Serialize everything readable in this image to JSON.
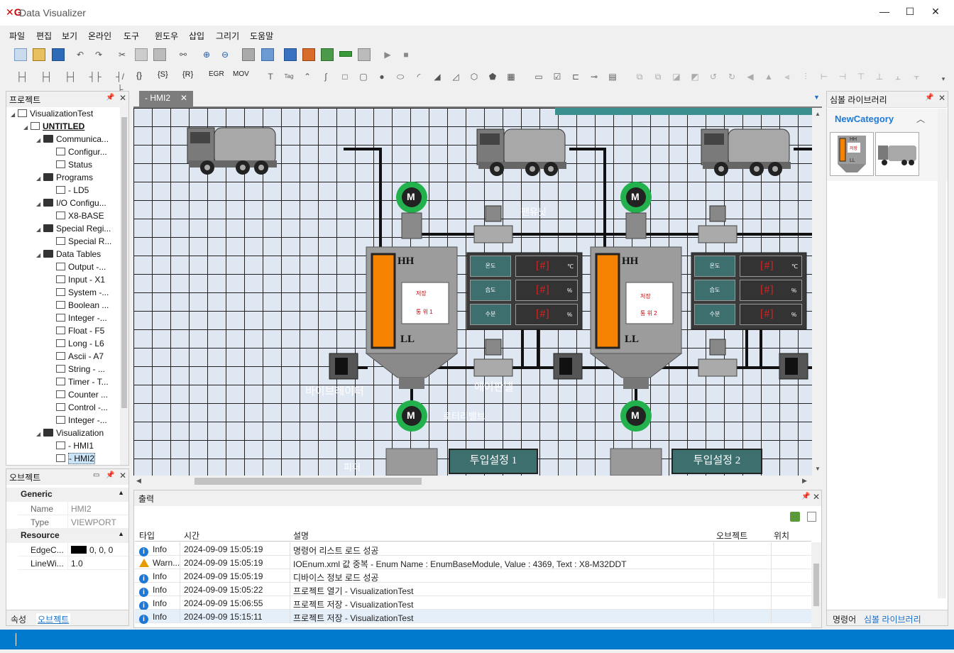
{
  "app": {
    "logo": "✕G",
    "title": "Data Visualizer"
  },
  "window_controls": {
    "minimize": "—",
    "maximize": "☐",
    "close": "✕"
  },
  "menu": [
    "파일",
    "편집",
    "보기",
    "온라인",
    "도구",
    "윈도우",
    "삽입",
    "그리기",
    "도움말"
  ],
  "toolbar2_text": [
    "{}",
    "{S}",
    "{R}",
    "EGR",
    "MOV"
  ],
  "project_panel": {
    "title": "프로젝트",
    "tree": [
      {
        "label": "VisualizationTest",
        "level": 0
      },
      {
        "label": "UNTITLED",
        "level": 1
      },
      {
        "label": "Communica...",
        "level": 2,
        "folder": true
      },
      {
        "label": "Configur...",
        "level": 3
      },
      {
        "label": "Status",
        "level": 3
      },
      {
        "label": "Programs",
        "level": 2,
        "folder": true
      },
      {
        "label": "- LD5",
        "level": 3
      },
      {
        "label": "I/O Configu...",
        "level": 2,
        "folder": true
      },
      {
        "label": "X8-BASE",
        "level": 3
      },
      {
        "label": "Special Regi...",
        "level": 2,
        "folder": true
      },
      {
        "label": "Special R...",
        "level": 3
      },
      {
        "label": "Data Tables",
        "level": 2,
        "folder": true
      },
      {
        "label": "Output -...",
        "level": 3
      },
      {
        "label": "Input - X1",
        "level": 3
      },
      {
        "label": "System -...",
        "level": 3
      },
      {
        "label": "Boolean ...",
        "level": 3
      },
      {
        "label": "Integer -...",
        "level": 3
      },
      {
        "label": "Float - F5",
        "level": 3
      },
      {
        "label": "Long - L6",
        "level": 3
      },
      {
        "label": "Ascii - A7",
        "level": 3
      },
      {
        "label": "String - ...",
        "level": 3
      },
      {
        "label": "Timer - T...",
        "level": 3
      },
      {
        "label": "Counter ...",
        "level": 3
      },
      {
        "label": "Control -...",
        "level": 3
      },
      {
        "label": "Integer -...",
        "level": 3
      },
      {
        "label": "Visualization",
        "level": 2,
        "folder": true
      },
      {
        "label": "- HMI1",
        "level": 3
      },
      {
        "label": "- HMI2",
        "level": 3
      }
    ]
  },
  "object_panel": {
    "title": "오브젝트",
    "group1": "Generic",
    "name_label": "Name",
    "name_value": "HMI2",
    "type_label": "Type",
    "type_value": "VIEWPORT",
    "group2": "Resource",
    "edge_label": "EdgeC...",
    "edge_value": "0, 0, 0",
    "line_label": "LineWi...",
    "line_value": "1.0",
    "tab_props": "속성",
    "tab_object": "오브젝트"
  },
  "document_tab": {
    "label": "- HMI2",
    "close": "✕"
  },
  "canvas": {
    "hh": "HH",
    "ll": "LL",
    "motor": "M",
    "label_fan": "팬유닛",
    "label_vibrator": "바이브레이터",
    "label_airpanel": "에어판넬",
    "label_rotary": "로터리밸브",
    "label_feeder": "피더",
    "btn_set1": "투입설정 1",
    "btn_set2": "투입설정 2",
    "tank1_text": [
      "저장",
      "통 위 1"
    ],
    "tank2_text": [
      "저장",
      "통 위 2"
    ],
    "panel_rows": [
      {
        "label": "온도",
        "value": "[#]",
        "unit": "℃"
      },
      {
        "label": "습도",
        "value": "[#]",
        "unit": "%"
      },
      {
        "label": "수분",
        "value": "[#]",
        "unit": "%"
      }
    ]
  },
  "symbol_library": {
    "title": "심볼 라이브러리",
    "category": "NewCategory",
    "tab_cmd": "명령어",
    "tab_lib": "심볼 라이브러리",
    "thumb_text": [
      "HH",
      "저장",
      "LL"
    ]
  },
  "output": {
    "title": "출력",
    "columns": [
      "타입",
      "시간",
      "설명",
      "오브젝트",
      "위치"
    ],
    "rows": [
      {
        "type": "Info",
        "kind": "info",
        "time": "2024-09-09 15:05:19",
        "desc": "명령어 리스트 로드 성공"
      },
      {
        "type": "Warn...",
        "kind": "warn",
        "time": "2024-09-09 15:05:19",
        "desc": "IOEnum.xml 값 중복 - Enum Name : EnumBaseModule, Value : 4369, Text : X8-M32DDT"
      },
      {
        "type": "Info",
        "kind": "info",
        "time": "2024-09-09 15:05:19",
        "desc": "디바이스 정보 로드 성공"
      },
      {
        "type": "Info",
        "kind": "info",
        "time": "2024-09-09 15:05:22",
        "desc": "프로젝트 열기 - VisualizationTest"
      },
      {
        "type": "Info",
        "kind": "info",
        "time": "2024-09-09 15:06:55",
        "desc": "프로젝트 저장 - VisualizationTest"
      },
      {
        "type": "Info",
        "kind": "info",
        "time": "2024-09-09 15:15:11",
        "desc": "프로젝트 저장 - VisualizationTest"
      }
    ]
  },
  "colors": {
    "accent": "#007acc",
    "tank_fill": "#f58200",
    "panel_teal": "#3d6f6f",
    "motor_green": "#22b14c",
    "value_red": "#e02020"
  }
}
